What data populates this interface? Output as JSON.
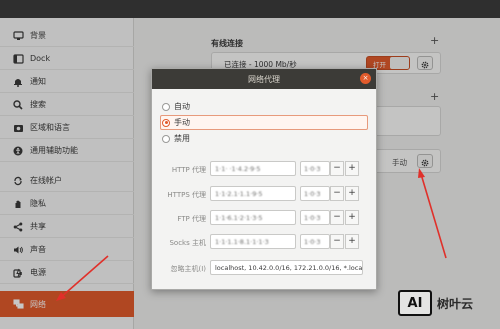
{
  "sidebar": {
    "items": [
      {
        "label": "背景",
        "icon": "monitor-icon"
      },
      {
        "label": "Dock",
        "icon": "dock-icon"
      },
      {
        "label": "通知",
        "icon": "bell-icon"
      },
      {
        "label": "搜索",
        "icon": "search-icon"
      },
      {
        "label": "区域和语言",
        "icon": "camera-icon"
      },
      {
        "label": "通用辅助功能",
        "icon": "accessibility-icon"
      },
      {
        "label": "在线帐户",
        "icon": "cloud-refresh-icon"
      },
      {
        "label": "隐私",
        "icon": "hand-icon"
      },
      {
        "label": "共享",
        "icon": "share-icon"
      },
      {
        "label": "声音",
        "icon": "speaker-icon"
      },
      {
        "label": "电源",
        "icon": "power-icon"
      },
      {
        "label": "网络",
        "icon": "network-icon"
      }
    ],
    "active_index": 11,
    "accent": "#e25b2c"
  },
  "main": {
    "wired_title": "有线连接",
    "wired_status": "已连接 - 1000 Mb/秒",
    "wired_toggle": "打开",
    "plus": "+",
    "proxy_mode": "手动"
  },
  "dialog": {
    "title": "网络代理",
    "close": "×",
    "modes": [
      {
        "label": "自动",
        "selected": false
      },
      {
        "label": "手动",
        "selected": true
      },
      {
        "label": "禁用",
        "selected": false
      }
    ],
    "fields": [
      {
        "label": "HTTP 代理",
        "value": "1·1· ·1·4.2·9·5",
        "port": "1·0·3"
      },
      {
        "label": "HTTPS 代理",
        "value": "1·1·2.1·1.1·9·5",
        "port": "1·0·3"
      },
      {
        "label": "FTP 代理",
        "value": "1·1·6.1·2·1·3·5",
        "port": "1·0·3"
      },
      {
        "label": "Socks 主机",
        "value": "1·1·1.1·8.1·1·1·3",
        "port": "1·0·3"
      }
    ],
    "minus": "−",
    "plus": "+",
    "ignore_label": "忽略主机(I)",
    "ignore_value": "localhost, 10.42.0.0/16, 172.21.0.0/16, *.local"
  },
  "watermark": {
    "logo": "AI",
    "text": "树叶云"
  }
}
